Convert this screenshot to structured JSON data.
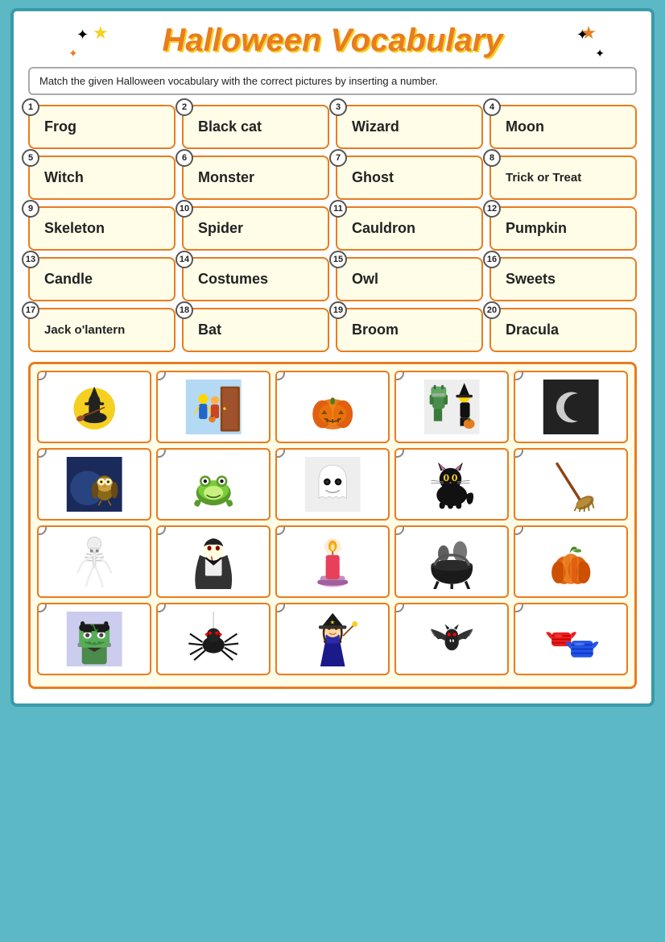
{
  "title": "Halloween Vocabulary",
  "instructions": "Match the given Halloween vocabulary with the correct pictures by inserting a number.",
  "vocab": [
    {
      "num": 1,
      "label": "Frog"
    },
    {
      "num": 2,
      "label": "Black cat"
    },
    {
      "num": 3,
      "label": "Wizard"
    },
    {
      "num": 4,
      "label": "Moon"
    },
    {
      "num": 5,
      "label": "Witch"
    },
    {
      "num": 6,
      "label": "Monster"
    },
    {
      "num": 7,
      "label": "Ghost"
    },
    {
      "num": 8,
      "label": "Trick or Treat",
      "small": true
    },
    {
      "num": 9,
      "label": "Skeleton"
    },
    {
      "num": 10,
      "label": "Spider"
    },
    {
      "num": 11,
      "label": "Cauldron"
    },
    {
      "num": 12,
      "label": "Pumpkin"
    },
    {
      "num": 13,
      "label": "Candle"
    },
    {
      "num": 14,
      "label": "Costumes"
    },
    {
      "num": 15,
      "label": "Owl"
    },
    {
      "num": 16,
      "label": "Sweets"
    },
    {
      "num": 17,
      "label": "Jack o'lantern",
      "small": true
    },
    {
      "num": 18,
      "label": "Bat"
    },
    {
      "num": 19,
      "label": "Broom"
    },
    {
      "num": 20,
      "label": "Dracula"
    }
  ],
  "rows": [
    [
      "witch-moon",
      "trick-or-treat",
      "pumpkin-jack",
      "costumes",
      "crescent-moon"
    ],
    [
      "owl-moon",
      "frog",
      "ghost",
      "black-cat",
      "broom"
    ],
    [
      "skeleton",
      "dracula",
      "candle",
      "cauldron",
      "pumpkin"
    ],
    [
      "monster",
      "spider",
      "witch2",
      "bat",
      "sweets"
    ]
  ]
}
